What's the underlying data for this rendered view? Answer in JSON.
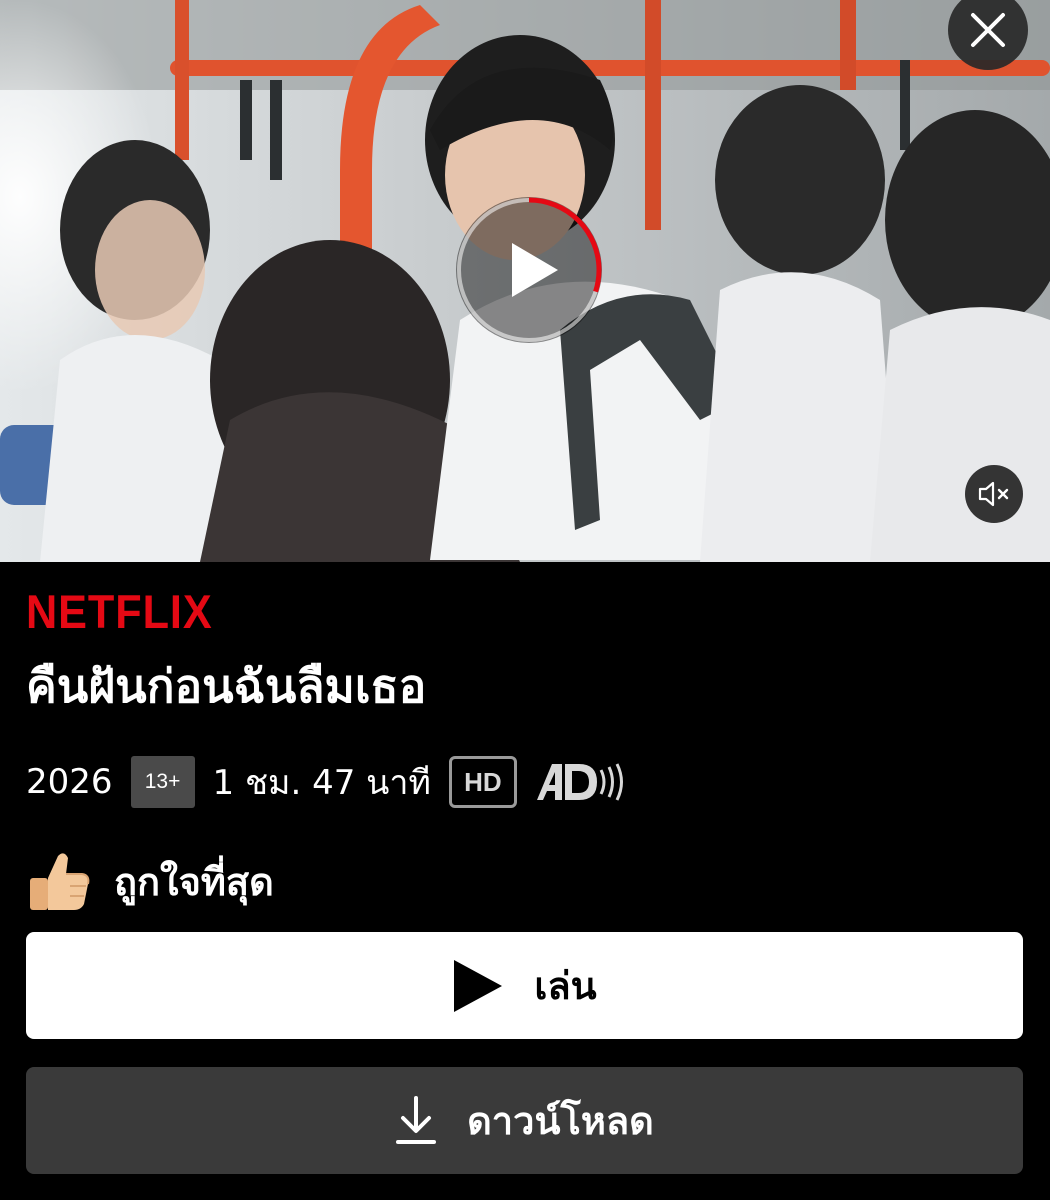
{
  "brand": "NETFLIX",
  "title": "คืนฝันก่อนฉันลืมเธอ",
  "meta": {
    "year": "2026",
    "rating": "13+",
    "duration": "1 ชม. 47 นาที",
    "quality": "HD",
    "audio_description_icon": "audio-description-icon"
  },
  "top_pick": {
    "icon": "thumbs-up-icon",
    "label": "ถูกใจที่สุด"
  },
  "actions": {
    "play_label": "เล่น",
    "download_label": "ดาวน์โหลด"
  },
  "preview": {
    "progress": 0.3,
    "muted": true
  },
  "colors": {
    "brand_red": "#e50914",
    "background": "#000000",
    "play_button_bg": "#ffffff",
    "download_button_bg": "#3a3a3a",
    "rating_bg": "#4a4a4a"
  }
}
